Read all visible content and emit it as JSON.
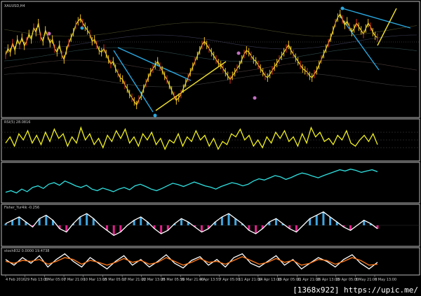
{
  "chart_data": {
    "type": "line",
    "panels": [
      {
        "name": "price",
        "label": "XAUUSD,H4",
        "series": [
          {
            "color": "#f0e030",
            "values": [
              0.55,
              0.62,
              0.58,
              0.68,
              0.6,
              0.72,
              0.66,
              0.74,
              0.65,
              0.7,
              0.78,
              0.72,
              0.85,
              0.8,
              0.9,
              0.75,
              0.7,
              0.82,
              0.76,
              0.68,
              0.72,
              0.62,
              0.58,
              0.66,
              0.55,
              0.5,
              0.6,
              0.68,
              0.74,
              0.8,
              0.88,
              0.92,
              0.95,
              0.9,
              0.86,
              0.82,
              0.78,
              0.7,
              0.72,
              0.66,
              0.6,
              0.58,
              0.62,
              0.56,
              0.5,
              0.45,
              0.48,
              0.4,
              0.35,
              0.3,
              0.28,
              0.22,
              0.18,
              0.12,
              0.08,
              0.04,
              0.0,
              0.06,
              0.1,
              0.18,
              0.24,
              0.3,
              0.36,
              0.4,
              0.44,
              0.48,
              0.42,
              0.38,
              0.32,
              0.28,
              0.22,
              0.16,
              0.1,
              0.05,
              0.08,
              0.12,
              0.18,
              0.24,
              0.3,
              0.36,
              0.42,
              0.48,
              0.54,
              0.6,
              0.66,
              0.7,
              0.66,
              0.62,
              0.58,
              0.54,
              0.5,
              0.46,
              0.44,
              0.4,
              0.36,
              0.32,
              0.28,
              0.32,
              0.36,
              0.4,
              0.44,
              0.5,
              0.56,
              0.6,
              0.58,
              0.54,
              0.5,
              0.48,
              0.44,
              0.4,
              0.36,
              0.32,
              0.3,
              0.34,
              0.38,
              0.42,
              0.46,
              0.5,
              0.54,
              0.58,
              0.62,
              0.66,
              0.6,
              0.56,
              0.52,
              0.48,
              0.44,
              0.4,
              0.38,
              0.36,
              0.32,
              0.3,
              0.34,
              0.38,
              0.44,
              0.5,
              0.56,
              0.62,
              0.68,
              0.74,
              0.82,
              0.9,
              0.96,
              1.0,
              0.94,
              0.88,
              0.92,
              0.86,
              0.8,
              0.84,
              0.9,
              0.86,
              0.82,
              0.78,
              0.84,
              0.9,
              0.86,
              0.8,
              0.76,
              0.74
            ]
          }
        ]
      },
      {
        "name": "rsi",
        "label": "RSI(5) 28.0816",
        "series": [
          {
            "color": "#f0f020",
            "values": [
              0.4,
              0.6,
              0.3,
              0.7,
              0.5,
              0.8,
              0.4,
              0.65,
              0.35,
              0.75,
              0.45,
              0.85,
              0.55,
              0.7,
              0.3,
              0.6,
              0.4,
              0.9,
              0.5,
              0.7,
              0.35,
              0.55,
              0.25,
              0.65,
              0.45,
              0.8,
              0.55,
              0.85,
              0.4,
              0.6,
              0.3,
              0.7,
              0.5,
              0.75,
              0.35,
              0.55,
              0.2,
              0.5,
              0.4,
              0.7,
              0.3,
              0.6,
              0.45,
              0.8,
              0.5,
              0.65,
              0.3,
              0.55,
              0.2,
              0.45,
              0.35,
              0.7,
              0.6,
              0.85,
              0.5,
              0.65,
              0.3,
              0.5,
              0.25,
              0.6,
              0.4,
              0.75,
              0.55,
              0.8,
              0.45,
              0.6,
              0.3,
              0.7,
              0.4,
              0.9,
              0.6,
              0.75,
              0.45,
              0.55,
              0.35,
              0.65,
              0.5,
              0.8,
              0.4,
              0.3,
              0.5,
              0.65,
              0.45,
              0.7,
              0.35
            ]
          }
        ]
      },
      {
        "name": "bands",
        "label": "",
        "series": [
          {
            "color": "#30e0e0",
            "values": [
              0.2,
              0.25,
              0.18,
              0.3,
              0.22,
              0.35,
              0.4,
              0.32,
              0.45,
              0.5,
              0.42,
              0.55,
              0.48,
              0.4,
              0.35,
              0.42,
              0.3,
              0.25,
              0.33,
              0.28,
              0.22,
              0.3,
              0.35,
              0.28,
              0.4,
              0.45,
              0.38,
              0.3,
              0.25,
              0.32,
              0.4,
              0.48,
              0.44,
              0.38,
              0.45,
              0.52,
              0.46,
              0.4,
              0.36,
              0.3,
              0.38,
              0.44,
              0.5,
              0.46,
              0.4,
              0.45,
              0.55,
              0.62,
              0.58,
              0.65,
              0.72,
              0.68,
              0.6,
              0.66,
              0.74,
              0.8,
              0.76,
              0.7,
              0.65,
              0.72,
              0.78,
              0.84,
              0.9,
              0.86,
              0.92,
              0.88,
              0.82,
              0.86,
              0.9,
              0.84
            ]
          }
        ]
      },
      {
        "name": "fisher",
        "label": "Fisher_Yur4ik -0.256",
        "series": [
          {
            "color": "#ffffff",
            "values": [
              0.1,
              0.3,
              0.5,
              0.2,
              -0.1,
              0.4,
              0.6,
              0.3,
              -0.2,
              -0.4,
              0.1,
              0.5,
              0.7,
              0.4,
              0.0,
              -0.3,
              -0.6,
              -0.4,
              0.0,
              0.3,
              0.5,
              0.2,
              -0.2,
              -0.5,
              -0.3,
              0.1,
              0.4,
              0.2,
              -0.1,
              -0.4,
              -0.2,
              0.2,
              0.5,
              0.7,
              0.4,
              0.1,
              -0.3,
              -0.5,
              -0.2,
              0.2,
              0.4,
              0.1,
              -0.2,
              -0.4,
              0.0,
              0.4,
              0.6,
              0.8,
              0.5,
              0.2,
              -0.1,
              -0.3,
              0.0,
              0.3,
              0.1,
              -0.2
            ]
          }
        ]
      },
      {
        "name": "stochastic",
        "label": "stoch832 0.0000 19.4738",
        "series": [
          {
            "color": "#ffffff",
            "values": [
              0.6,
              0.3,
              0.7,
              0.4,
              0.8,
              0.2,
              0.6,
              0.9,
              0.5,
              0.2,
              0.7,
              0.4,
              0.1,
              0.5,
              0.8,
              0.3,
              0.6,
              0.2,
              0.5,
              0.85,
              0.4,
              0.15,
              0.55,
              0.75,
              0.3,
              0.6,
              0.2,
              0.7,
              0.9,
              0.4,
              0.2,
              0.5,
              0.8,
              0.3,
              0.6,
              0.1,
              0.4,
              0.7,
              0.5,
              0.2,
              0.6,
              0.85,
              0.4,
              0.1,
              0.45
            ]
          },
          {
            "color": "#ff7a1a",
            "values": [
              0.5,
              0.4,
              0.55,
              0.5,
              0.6,
              0.35,
              0.5,
              0.7,
              0.6,
              0.35,
              0.55,
              0.45,
              0.3,
              0.45,
              0.65,
              0.45,
              0.55,
              0.35,
              0.45,
              0.7,
              0.5,
              0.3,
              0.45,
              0.65,
              0.45,
              0.5,
              0.35,
              0.55,
              0.75,
              0.55,
              0.35,
              0.45,
              0.65,
              0.45,
              0.55,
              0.3,
              0.4,
              0.6,
              0.55,
              0.35,
              0.5,
              0.7,
              0.55,
              0.3,
              0.35
            ]
          }
        ]
      }
    ],
    "x_tick_labels": [
      "4 Feb 2016",
      "29 Feb 13:00",
      "3 Mar 05:00",
      "7 Mar 21:00",
      "10 Mar 13:00",
      "15 Mar 05:00",
      "17 Mar 21:00",
      "22 Mar 13:00",
      "25 Mar 05:55",
      "30 Mar 21:00",
      "4 Apr 13:55",
      "7 Apr 05:00",
      "11 Apr 21:00",
      "14 Apr 13:00",
      "19 Apr 05:00",
      "21 Apr 21:00",
      "26 Apr 13:00",
      "29 Apr 05:00",
      "3 May 21:00",
      "6 May 13:00"
    ]
  },
  "watermark": "[1368x922] https://upic.me/"
}
